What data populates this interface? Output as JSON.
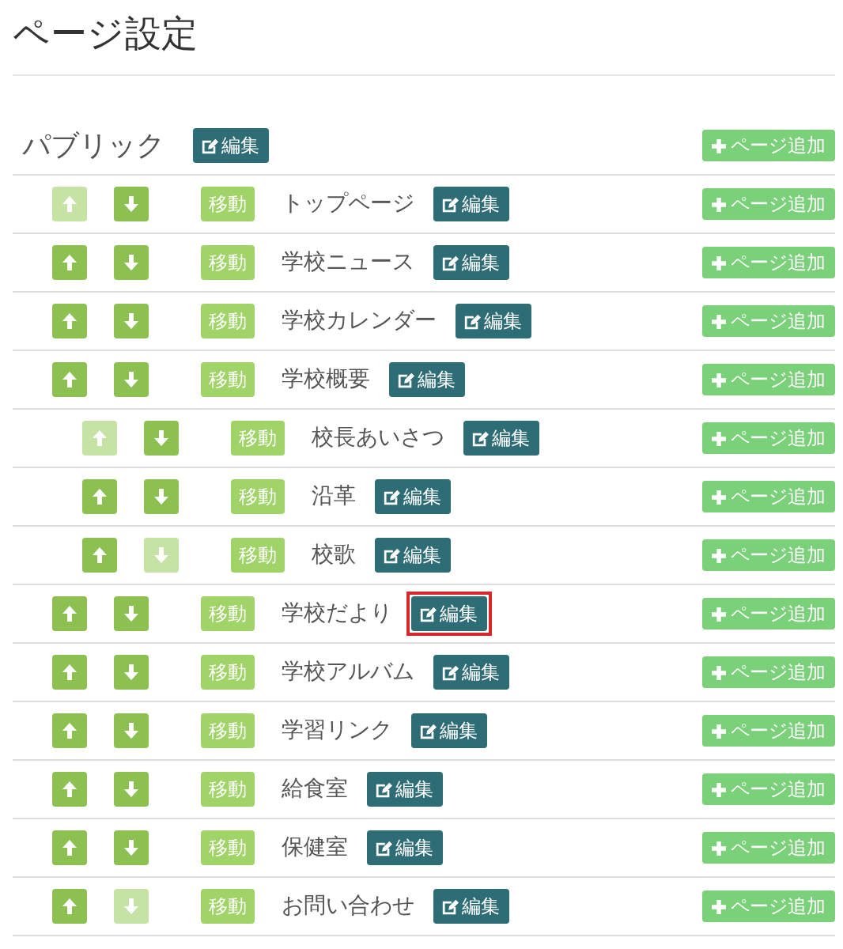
{
  "title": "ページ設定",
  "root": {
    "label": "パブリック",
    "edit_label": "編集",
    "add_label": "ページ追加"
  },
  "pages": [
    {
      "title": "トップページ",
      "up_disabled": true,
      "down_disabled": false,
      "highlighted": false,
      "move_label": "移動",
      "edit_label": "編集",
      "add_label": "ページ追加"
    },
    {
      "title": "学校ニュース",
      "up_disabled": false,
      "down_disabled": false,
      "highlighted": false,
      "move_label": "移動",
      "edit_label": "編集",
      "add_label": "ページ追加"
    },
    {
      "title": "学校カレンダー",
      "up_disabled": false,
      "down_disabled": false,
      "highlighted": false,
      "move_label": "移動",
      "edit_label": "編集",
      "add_label": "ページ追加"
    },
    {
      "title": "学校概要",
      "up_disabled": false,
      "down_disabled": false,
      "highlighted": false,
      "move_label": "移動",
      "edit_label": "編集",
      "add_label": "ページ追加",
      "children": [
        {
          "title": "校長あいさつ",
          "up_disabled": true,
          "down_disabled": false,
          "highlighted": false,
          "move_label": "移動",
          "edit_label": "編集",
          "add_label": "ページ追加"
        },
        {
          "title": "沿革",
          "up_disabled": false,
          "down_disabled": false,
          "highlighted": false,
          "move_label": "移動",
          "edit_label": "編集",
          "add_label": "ページ追加"
        },
        {
          "title": "校歌",
          "up_disabled": false,
          "down_disabled": true,
          "highlighted": false,
          "move_label": "移動",
          "edit_label": "編集",
          "add_label": "ページ追加"
        }
      ]
    },
    {
      "title": "学校だより",
      "up_disabled": false,
      "down_disabled": false,
      "highlighted": true,
      "move_label": "移動",
      "edit_label": "編集",
      "add_label": "ページ追加"
    },
    {
      "title": "学校アルバム",
      "up_disabled": false,
      "down_disabled": false,
      "highlighted": false,
      "move_label": "移動",
      "edit_label": "編集",
      "add_label": "ページ追加"
    },
    {
      "title": "学習リンク",
      "up_disabled": false,
      "down_disabled": false,
      "highlighted": false,
      "move_label": "移動",
      "edit_label": "編集",
      "add_label": "ページ追加"
    },
    {
      "title": "給食室",
      "up_disabled": false,
      "down_disabled": false,
      "highlighted": false,
      "move_label": "移動",
      "edit_label": "編集",
      "add_label": "ページ追加"
    },
    {
      "title": "保健室",
      "up_disabled": false,
      "down_disabled": false,
      "highlighted": false,
      "move_label": "移動",
      "edit_label": "編集",
      "add_label": "ページ追加"
    },
    {
      "title": "お問い合わせ",
      "up_disabled": false,
      "down_disabled": true,
      "highlighted": false,
      "move_label": "移動",
      "edit_label": "編集",
      "add_label": "ページ追加"
    }
  ]
}
